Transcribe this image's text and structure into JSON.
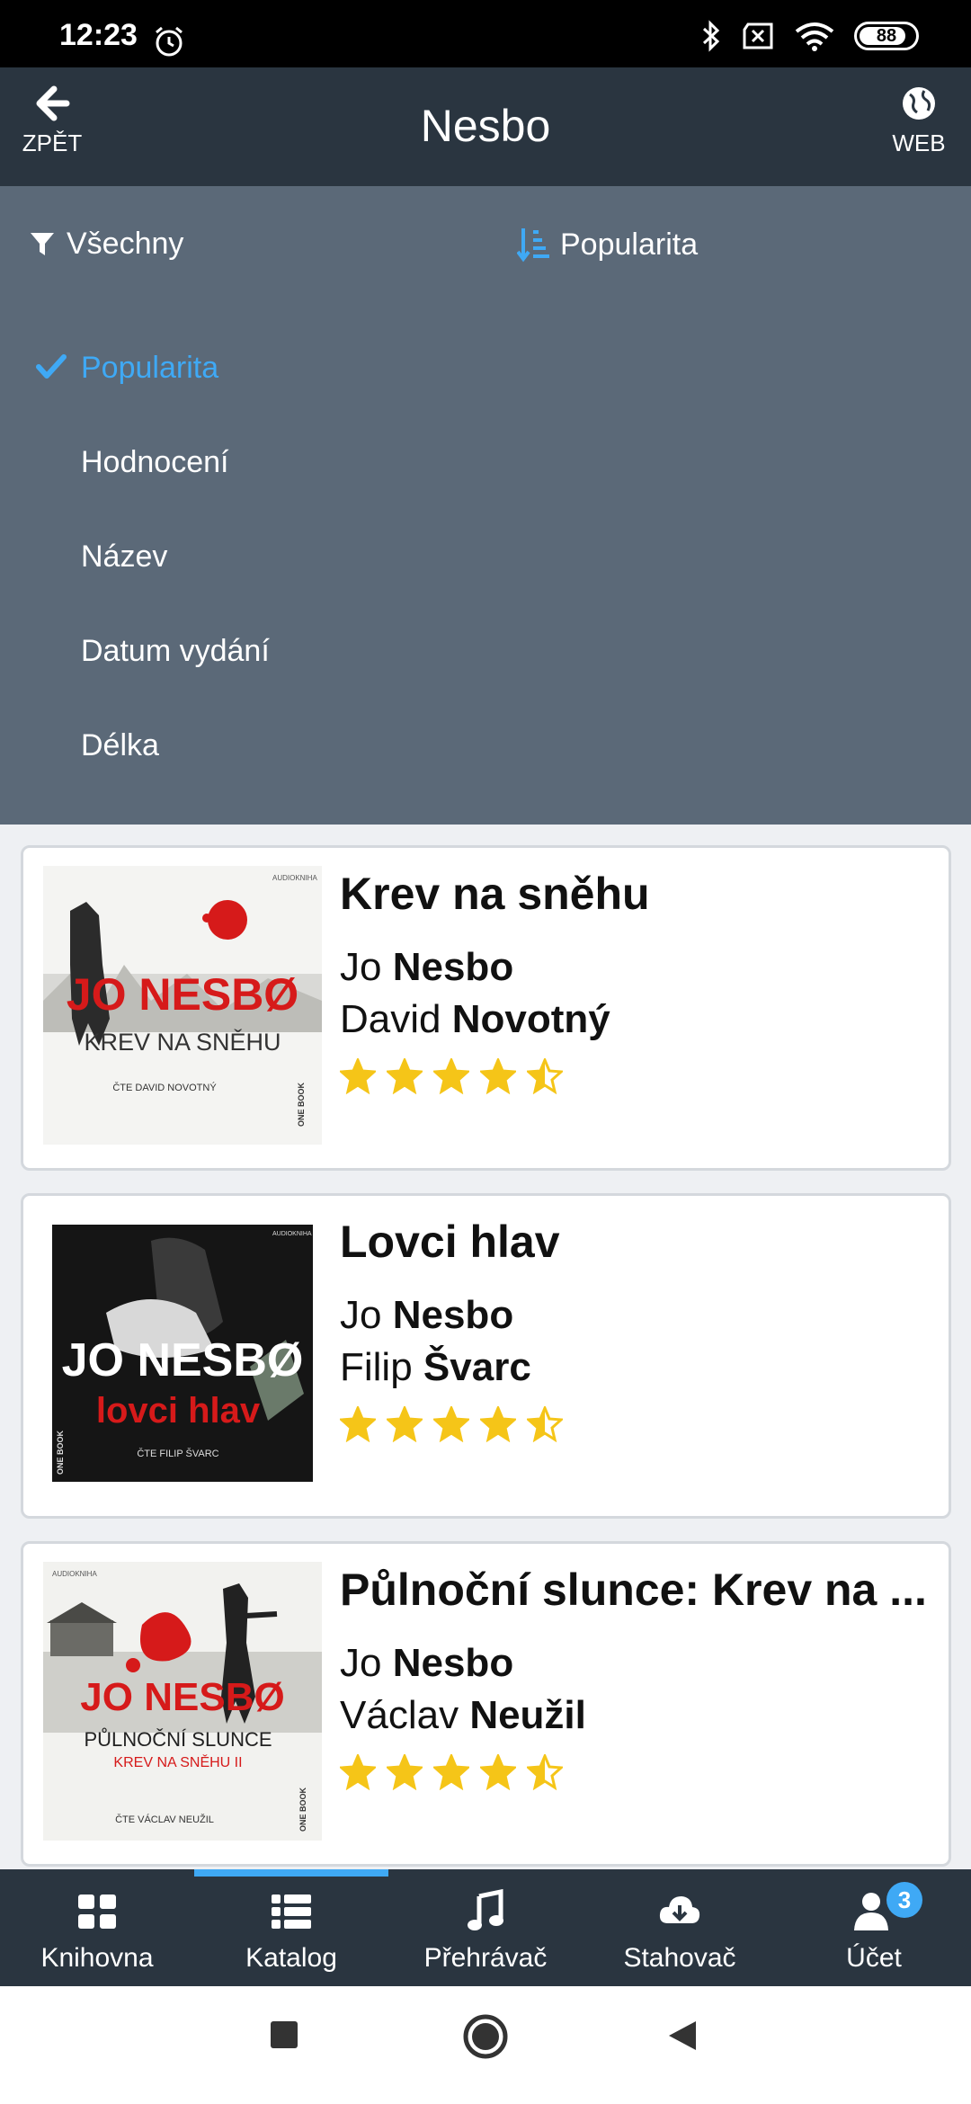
{
  "status_bar": {
    "time": "12:23",
    "battery": "88"
  },
  "header": {
    "back_label": "ZPĚT",
    "title": "Nesbo",
    "web_label": "WEB"
  },
  "panel": {
    "filter_label": "Všechny",
    "sort_label": "Popularita",
    "sort_options": [
      {
        "label": "Popularita",
        "selected": true
      },
      {
        "label": "Hodnocení",
        "selected": false
      },
      {
        "label": "Název",
        "selected": false
      },
      {
        "label": "Datum vydání",
        "selected": false
      },
      {
        "label": "Délka",
        "selected": false
      }
    ]
  },
  "books": [
    {
      "title": "Krev na sněhu",
      "author_first": "Jo",
      "author_last": "Nesbo",
      "narrator_first": "David",
      "narrator_last": "Novotný",
      "rating": 4.5,
      "cover": {
        "author": "JO NESBØ",
        "title": "KREV NA SNĚHU",
        "narrator": "ČTE DAVID NOVOTNÝ",
        "label": "AUDIOKNIHA",
        "publisher": "ONE BOOK"
      }
    },
    {
      "title": "Lovci hlav",
      "author_first": "Jo",
      "author_last": "Nesbo",
      "narrator_first": "Filip",
      "narrator_last": "Švarc",
      "rating": 4.5,
      "cover": {
        "author": "JO NESBØ",
        "title": "lovci hlav",
        "narrator": "ČTE FILIP ŠVARC",
        "label": "AUDIOKNIHA",
        "publisher": "ONE BOOK"
      }
    },
    {
      "title": "Půlnoční slunce: Krev na ...",
      "author_first": "Jo",
      "author_last": "Nesbo",
      "narrator_first": "Václav",
      "narrator_last": "Neužil",
      "rating": 4.5,
      "cover": {
        "author": "JO NESBØ",
        "title": "PŮLNOČNÍ SLUNCE",
        "subtitle": "KREV NA SNĚHU II",
        "narrator": "ČTE VÁCLAV NEUŽIL",
        "label": "AUDIOKNIHA",
        "publisher": "ONE BOOK"
      }
    }
  ],
  "bottom_nav": {
    "items": [
      {
        "label": "Knihovna",
        "icon": "grid-icon"
      },
      {
        "label": "Katalog",
        "icon": "list-icon"
      },
      {
        "label": "Přehrávač",
        "icon": "music-note-icon"
      },
      {
        "label": "Stahovač",
        "icon": "cloud-download-icon"
      },
      {
        "label": "Účet",
        "icon": "user-icon"
      }
    ],
    "active_index": 1,
    "account_badge": "3"
  },
  "colors": {
    "header": "#2a3540",
    "panel": "#5b6978",
    "accent": "#3fa9f5",
    "star": "#f5c518"
  }
}
